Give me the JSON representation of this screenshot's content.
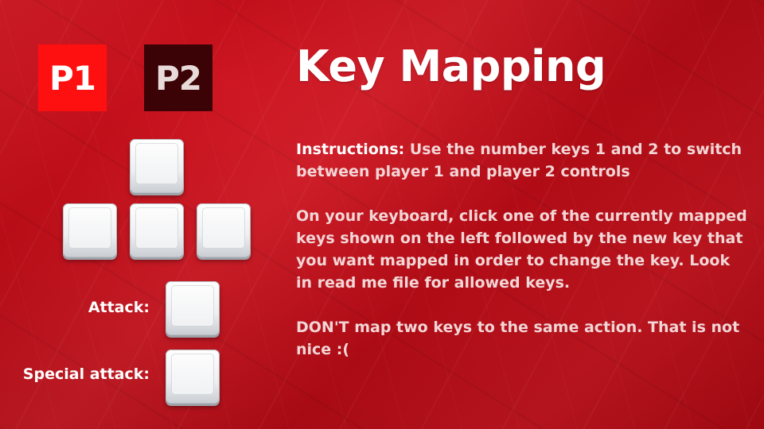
{
  "players": {
    "p1_label": "P1",
    "p2_label": "P2",
    "active": "P1"
  },
  "title": "Key Mapping",
  "movement_keys": {
    "up": "",
    "left": "",
    "down": "",
    "right": ""
  },
  "actions": {
    "attack_label": "Attack:",
    "special_attack_label": "Special attack:",
    "attack_key": "",
    "special_attack_key": ""
  },
  "instructions": {
    "heading": "Instructions:",
    "line1": "Use the number keys 1 and 2 to switch between player 1 and player 2 controls",
    "paragraph2": "On your keyboard, click one of the currently mapped keys shown on the left followed by the new key that you want mapped in order to change the key. Look in read me file for allowed keys.",
    "paragraph3": "DON'T map two keys to the same action. That is not nice :("
  },
  "colors": {
    "background": "#c00d18",
    "active_tab": "#ff1010",
    "inactive_tab": "#3b0306",
    "title_text": "#ffffff",
    "body_text": "#f2d6d6"
  }
}
